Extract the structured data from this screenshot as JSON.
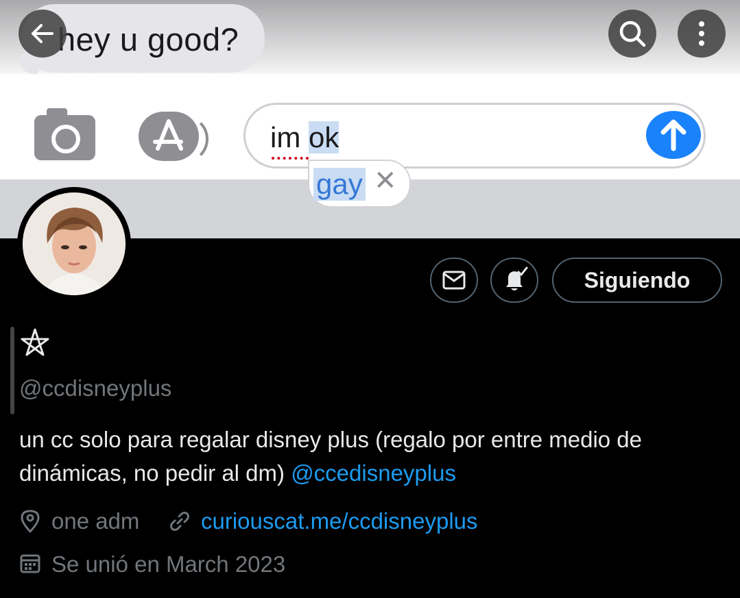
{
  "banner": {
    "received_message": "hey u good?",
    "typed_plain": "im",
    "typed_selected": "ok",
    "autocorrect_suggestion": "gay"
  },
  "profile": {
    "name_glyph": "⛧",
    "handle": "@ccdisneyplus",
    "bio_text": "un cc solo para regalar disney plus (regalo por entre medio de dinámicas, no pedir al dm)",
    "bio_mention": "@ccedisneyplus",
    "location": "one adm",
    "website": "curiouscat.me/ccdisneyplus",
    "joined": "Se unió en March 2023",
    "follow_button": "Siguiendo"
  },
  "icons": [
    "back-arrow-icon",
    "search-icon",
    "more-options-icon",
    "mail-icon",
    "notification-bell-icon",
    "location-pin-icon",
    "link-icon",
    "calendar-icon",
    "camera-icon",
    "app-store-icon",
    "send-arrow-icon"
  ],
  "colors": {
    "accent": "#1d9bf0",
    "muted": "#71767b",
    "text": "#e7e9ea",
    "imessage_blue": "#1a82fb"
  }
}
